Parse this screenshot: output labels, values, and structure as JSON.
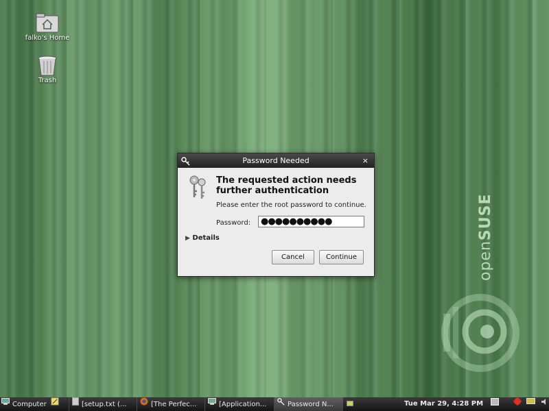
{
  "desktop": {
    "icons": [
      {
        "label": "falko's Home"
      },
      {
        "label": "Trash"
      }
    ],
    "watermark": {
      "prefix": "open",
      "brand": "SUSE"
    }
  },
  "dialog": {
    "title": "Password Needed",
    "close_glyph": "×",
    "heading": "The requested action needs further authentication",
    "subtitle": "Please enter the root password to continue.",
    "password_label": "Password:",
    "password_value": "●●●●●●●●●●",
    "details_label": "Details",
    "cancel_label": "Cancel",
    "continue_label": "Continue"
  },
  "taskbar": {
    "menu_label": "Computer",
    "tasks": [
      {
        "label": "[setup.txt (..."
      },
      {
        "label": "[The Perfec..."
      },
      {
        "label": "[Application..."
      },
      {
        "label": "Password N..."
      }
    ],
    "clock": "Tue Mar 29,  4:28 PM"
  },
  "colors": {
    "accent": "#4c7a4c",
    "titlebar": "#232323"
  }
}
